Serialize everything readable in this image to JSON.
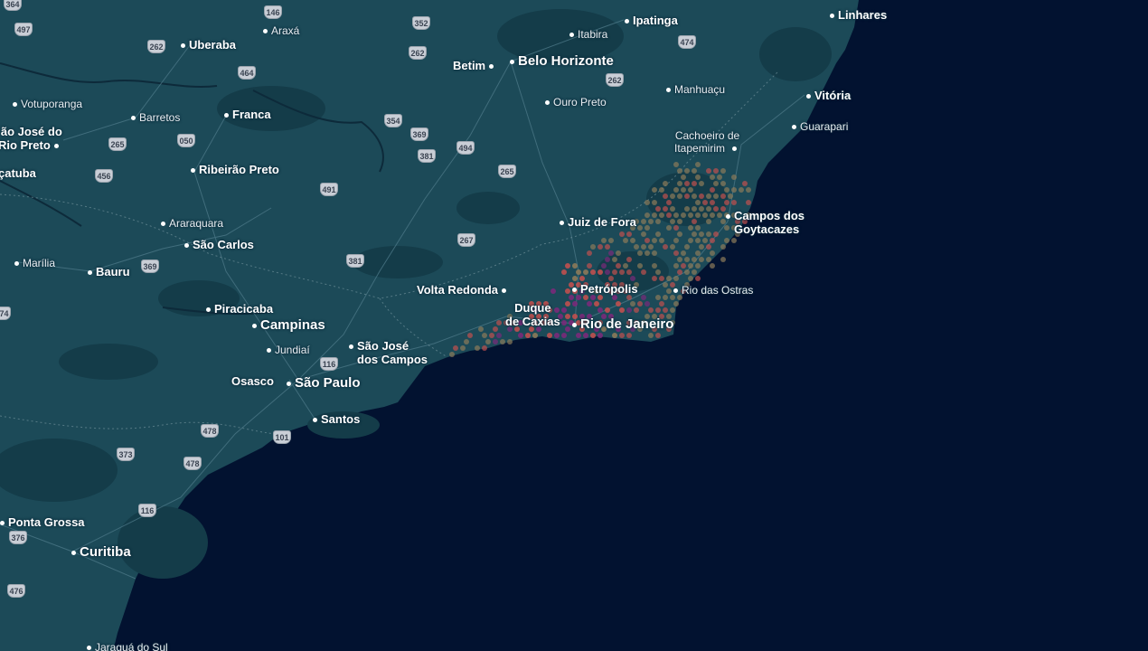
{
  "map": {
    "colors": {
      "land": "#1c4a58",
      "land_dark": "#123a47",
      "ocean": "#021230",
      "roads": "#4a7685",
      "hex_low": "#8c7a5a",
      "hex_mid": "#c0504f",
      "hex_high": "#7a2a7a"
    },
    "cities": [
      {
        "id": "linhares",
        "name": "Linhares",
        "size": "med"
      },
      {
        "id": "ipatinga",
        "name": "Ipatinga",
        "size": "med"
      },
      {
        "id": "itabira",
        "name": "Itabira",
        "size": "small"
      },
      {
        "id": "araxa",
        "name": "Araxá",
        "size": "small"
      },
      {
        "id": "uberaba",
        "name": "Uberaba",
        "size": "med"
      },
      {
        "id": "betim",
        "name": "Betim",
        "size": "med"
      },
      {
        "id": "belo-horizonte",
        "name": "Belo Horizonte",
        "size": "big"
      },
      {
        "id": "vitoria",
        "name": "Vitória",
        "size": "med"
      },
      {
        "id": "manhuacu",
        "name": "Manhuaçu",
        "size": "small"
      },
      {
        "id": "votuporanga",
        "name": "Votuporanga",
        "size": "small"
      },
      {
        "id": "barretos",
        "name": "Barretos",
        "size": "small"
      },
      {
        "id": "franca",
        "name": "Franca",
        "size": "med"
      },
      {
        "id": "ouro-preto",
        "name": "Ouro Preto",
        "size": "small"
      },
      {
        "id": "guarapari",
        "name": "Guarapari",
        "size": "small"
      },
      {
        "id": "sao-jose-rio-preto-1",
        "name": "ão José do",
        "size": "med"
      },
      {
        "id": "sao-jose-rio-preto-2",
        "name": "Rio Preto",
        "size": "med"
      },
      {
        "id": "cachoeiro-1",
        "name": "Cachoeiro de",
        "size": "small"
      },
      {
        "id": "cachoeiro-2",
        "name": "Itapemirim",
        "size": "small"
      },
      {
        "id": "catuba",
        "name": "çatuba",
        "size": "med"
      },
      {
        "id": "ribeirao-preto",
        "name": "Ribeirão Preto",
        "size": "med"
      },
      {
        "id": "campos-1",
        "name": "Campos dos",
        "size": "med"
      },
      {
        "id": "campos-2",
        "name": "Goytacazes",
        "size": "med"
      },
      {
        "id": "juiz-de-fora",
        "name": "Juiz de Fora",
        "size": "med"
      },
      {
        "id": "araraquara",
        "name": "Araraquara",
        "size": "small"
      },
      {
        "id": "sao-carlos",
        "name": "São Carlos",
        "size": "med"
      },
      {
        "id": "marilia",
        "name": "Marília",
        "size": "small"
      },
      {
        "id": "bauru",
        "name": "Bauru",
        "size": "med"
      },
      {
        "id": "volta-redonda",
        "name": "Volta Redonda",
        "size": "med"
      },
      {
        "id": "petropolis",
        "name": "Petrópolis",
        "size": "med"
      },
      {
        "id": "rio-das-ostras",
        "name": "Rio das Ostras",
        "size": "small"
      },
      {
        "id": "piracicaba",
        "name": "Piracicaba",
        "size": "med"
      },
      {
        "id": "duque-1",
        "name": "Duque",
        "size": "med"
      },
      {
        "id": "duque-2",
        "name": "de Caxias",
        "size": "med"
      },
      {
        "id": "rio-de-janeiro",
        "name": "Rio de Janeiro",
        "size": "big"
      },
      {
        "id": "campinas",
        "name": "Campinas",
        "size": "big"
      },
      {
        "id": "jundiai",
        "name": "Jundiaí",
        "size": "small"
      },
      {
        "id": "sjc-1",
        "name": "São José",
        "size": "med"
      },
      {
        "id": "sjc-2",
        "name": "dos Campos",
        "size": "med"
      },
      {
        "id": "osasco",
        "name": "Osasco",
        "size": "med"
      },
      {
        "id": "sao-paulo",
        "name": "São Paulo",
        "size": "big"
      },
      {
        "id": "santos",
        "name": "Santos",
        "size": "med"
      },
      {
        "id": "ponta-grossa",
        "name": "Ponta Grossa",
        "size": "med"
      },
      {
        "id": "curitiba",
        "name": "Curitiba",
        "size": "big"
      },
      {
        "id": "jaragua",
        "name": "Jaraguá do Sul",
        "size": "small"
      }
    ],
    "highways": [
      "364",
      "146",
      "352",
      "497",
      "262",
      "464",
      "474",
      "262",
      "262",
      "354",
      "369",
      "050",
      "265",
      "494",
      "381",
      "456",
      "265",
      "491",
      "267",
      "369",
      "381",
      "374",
      "116",
      "478",
      "101",
      "373",
      "478",
      "116",
      "376",
      "476"
    ]
  }
}
